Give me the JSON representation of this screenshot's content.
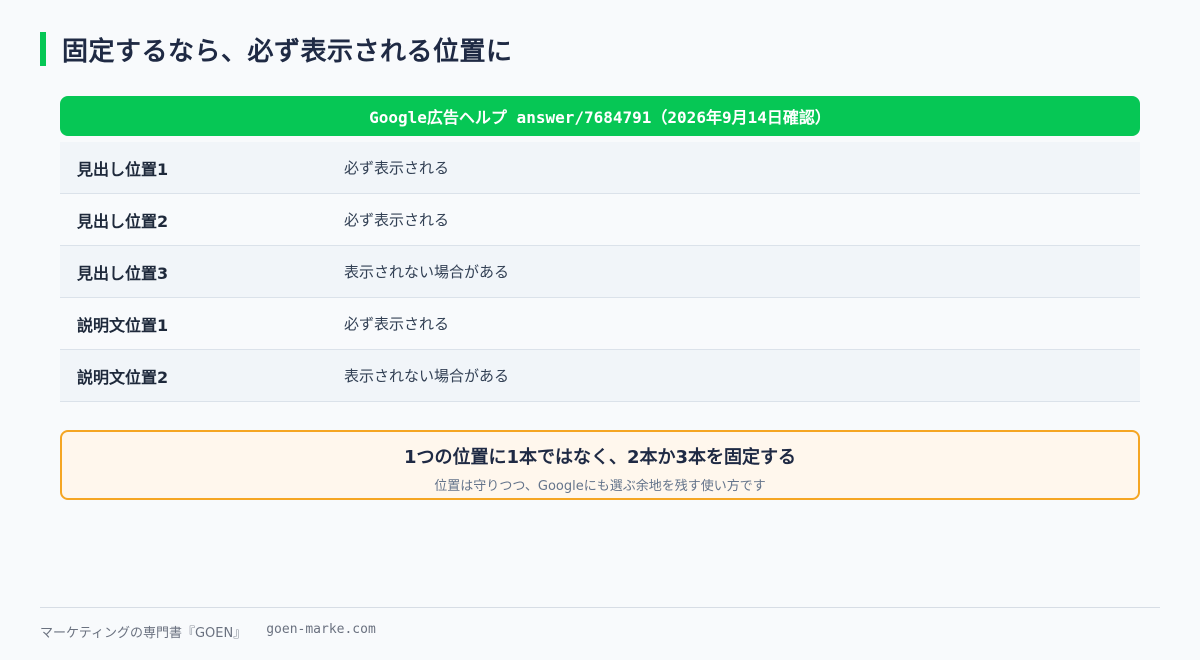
{
  "page": {
    "title": "固定するなら、必ず表示される位置に"
  },
  "table": {
    "header": "Google広告ヘルプ answer/7684791（2026年9月14日確認）",
    "rows": [
      {
        "label": "見出し位置1",
        "value": "必ず表示される"
      },
      {
        "label": "見出し位置2",
        "value": "必ず表示される"
      },
      {
        "label": "見出し位置3",
        "value": "表示されない場合がある"
      },
      {
        "label": "説明文位置1",
        "value": "必ず表示される"
      },
      {
        "label": "説明文位置2",
        "value": "表示されない場合がある"
      }
    ]
  },
  "callout": {
    "title": "1つの位置に1本ではなく、2本か3本を固定する",
    "subtitle": "位置は守りつつ、Googleにも選ぶ余地を残す使い方です"
  },
  "footer": {
    "brand": "マーケティングの専門書『GOEN』",
    "site": "goen-marke.com"
  },
  "colors": {
    "accent": "#06c755",
    "callout_border": "#f5a623",
    "callout_bg": "#fff7ed"
  }
}
